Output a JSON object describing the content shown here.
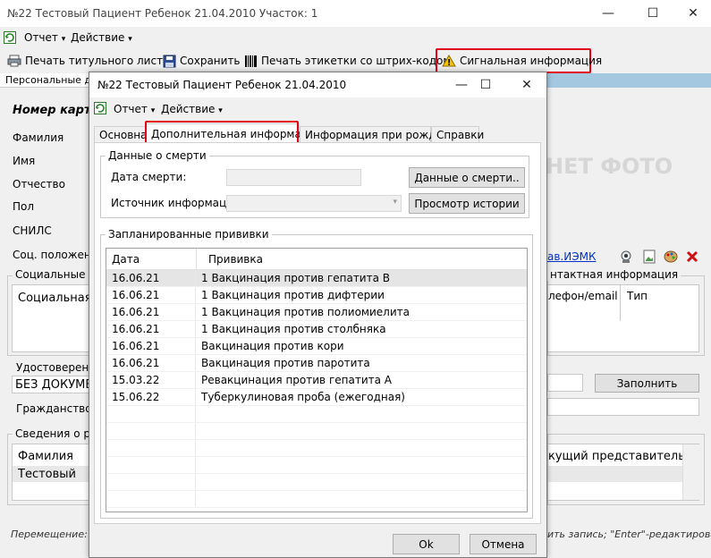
{
  "window": {
    "title": "№22 Тестовый Пациент Ребенок 21.04.2010 Участок: 1",
    "minimize": "—",
    "maximize": "☐",
    "close": "✕"
  },
  "menu": {
    "report": "Отчет",
    "action": "Действие",
    "arrow": "▾"
  },
  "toolbar": {
    "print_title": "Печать титульного листа",
    "save": "Сохранить",
    "print_barcode": "Печать этикетки со штрих-кодом",
    "signal": "Сигнальная информация"
  },
  "main": {
    "tab_personal": "Персональные да",
    "card_number": "Номер карт",
    "surname": "Фамилия",
    "name": "Имя",
    "patronymic": "Отчество",
    "sex": "Пол",
    "snils": "СНИЛС",
    "social_position": "Соц. положение",
    "no_photo": "НЕТ ФОТО",
    "emk_link": "ав.ИЭМК",
    "social_cat_group": "Социальные кат",
    "social_cat_col": "Социальная к",
    "contact_group": "нтактная информация",
    "phone_col": "лефон/email",
    "type_col": "Тип",
    "id_group": "Удостоверение",
    "no_doc": "БЕЗ ДОКУМЕ",
    "citizenship": "Гражданство",
    "fill_button": "Заполнить",
    "parents_group": "Сведения о род",
    "parents_surname_col": "Фамилия",
    "parents_surname_val": "Тестовый",
    "rep_col": "кущий представитель",
    "status_left": "Перемещение: \"Т",
    "status_right": "ить запись; \"Enter\"-редактировать"
  },
  "dialog": {
    "title": "№22 Тестовый Пациент Ребенок 21.04.2010",
    "menu_report": "Отчет",
    "menu_action": "Действие",
    "tabs": [
      "Основная",
      "Дополнительная информация",
      "Информация при рождении",
      "Справки"
    ],
    "death_group": "Данные о смерти",
    "death_date_label": "Дата смерти:",
    "death_source_label": "Источник информации:",
    "death_data_button": "Данные о смерти..",
    "history_button": "Просмотр истории",
    "vacc_group": "Запланированные прививки",
    "vacc_columns": {
      "date": "Дата",
      "vaccine": "Прививка"
    },
    "vaccinations": [
      {
        "date": "16.06.21",
        "name": "1 Вакцинация против гепатита В"
      },
      {
        "date": "16.06.21",
        "name": "1 Вакцинация против дифтерии"
      },
      {
        "date": "16.06.21",
        "name": "1 Вакцинация против полиомиелита"
      },
      {
        "date": "16.06.21",
        "name": "1 Вакцинация против столбняка"
      },
      {
        "date": "16.06.21",
        "name": "Вакцинация против кори"
      },
      {
        "date": "16.06.21",
        "name": "Вакцинация против паротита"
      },
      {
        "date": "15.03.22",
        "name": "Ревакцинация против гепатита А"
      },
      {
        "date": "15.06.22",
        "name": "Туберкулиновая проба (ежегодная)"
      }
    ],
    "ok": "Ok",
    "cancel": "Отмена"
  },
  "colors": {
    "highlight": "#e0001a",
    "selected_row": "#e5e5e5"
  }
}
